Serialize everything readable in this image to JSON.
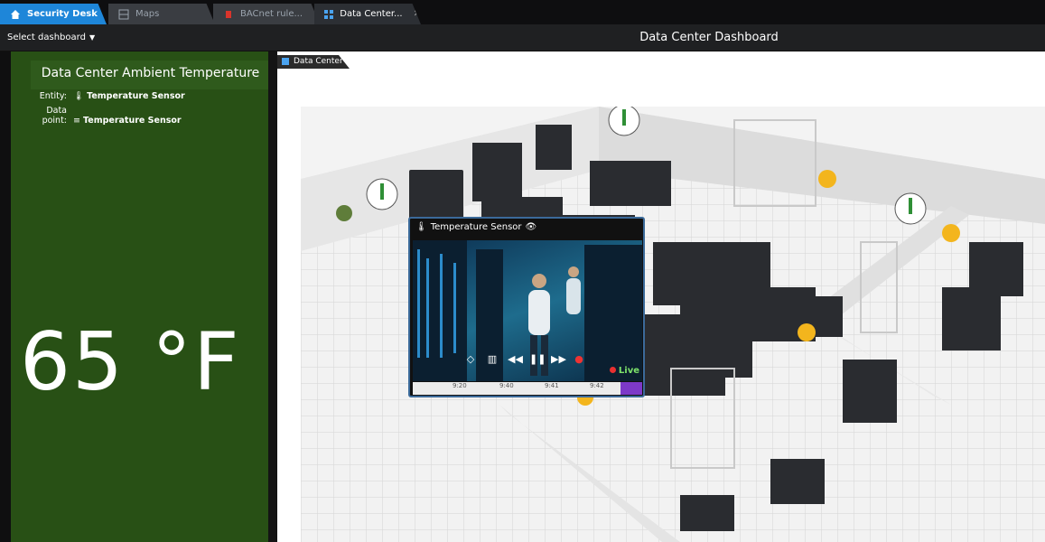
{
  "tabs": [
    {
      "label": "Security Desk",
      "icon": "home-icon"
    },
    {
      "label": "Maps",
      "icon": "map-icon"
    },
    {
      "label": "BACnet rule...",
      "icon": "rule-icon"
    },
    {
      "label": "Data Center...",
      "icon": "dashboard-icon"
    }
  ],
  "header": {
    "select_dashboard": "Select dashboard",
    "title": "Data Center Dashboard"
  },
  "panel": {
    "title": "Data Center Ambient Temperature",
    "entity_label": "Entity:",
    "entity_value": "Temperature Sensor",
    "datapoint_label": "Data point:",
    "datapoint_value": "Temperature Sensor",
    "temperature": "65 °F"
  },
  "main": {
    "tab_label": "Data Center"
  },
  "video": {
    "title": "Temperature Sensor",
    "live": "Live",
    "ticks": [
      "9:20",
      "9:40",
      "9:41",
      "9:42"
    ]
  },
  "colors": {
    "accent": "#1e86d9",
    "panel_green": "#285015",
    "live_green": "#7de26a"
  }
}
